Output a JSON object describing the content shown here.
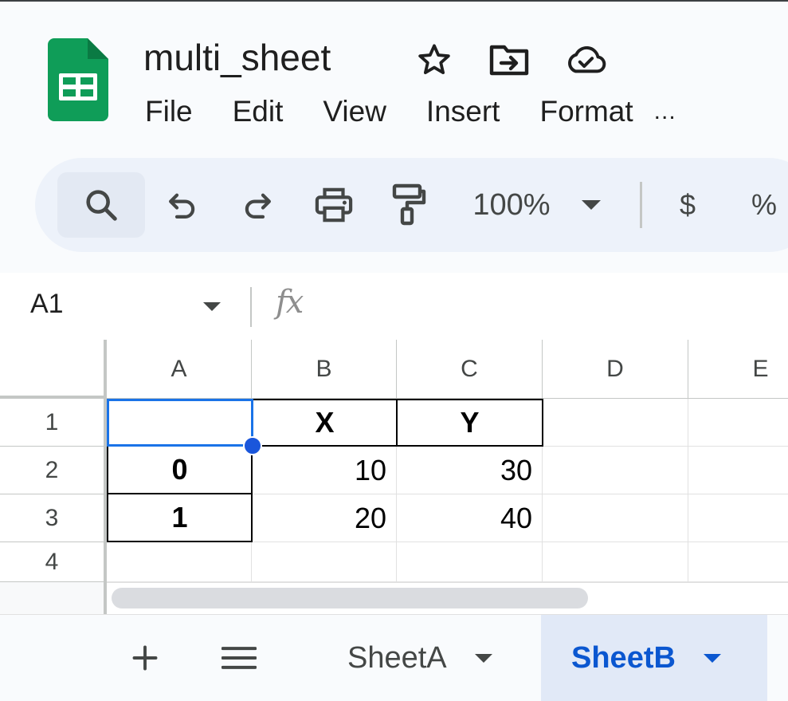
{
  "header": {
    "title": "multi_sheet",
    "menu": [
      "File",
      "Edit",
      "View",
      "Insert",
      "Format"
    ],
    "menu_more": "..."
  },
  "toolbar": {
    "zoom": "100%",
    "currency": "$",
    "percent": "%"
  },
  "formula_bar": {
    "name_box": "A1",
    "fx": "fx"
  },
  "grid": {
    "columns": [
      "A",
      "B",
      "C",
      "D",
      "E"
    ],
    "rows": [
      "1",
      "2",
      "3",
      "4"
    ],
    "cells": {
      "B1": "X",
      "C1": "Y",
      "A2": "0",
      "B2": "10",
      "C2": "30",
      "A3": "1",
      "B3": "20",
      "C3": "40"
    },
    "selected_cell": "A1"
  },
  "sheets": {
    "tabs": [
      {
        "label": "SheetA",
        "active": false
      },
      {
        "label": "SheetB",
        "active": true
      }
    ]
  },
  "colors": {
    "sheets_green": "#0f9d58",
    "selection_blue": "#1a73e8",
    "active_tab_text": "#0b57d0"
  }
}
